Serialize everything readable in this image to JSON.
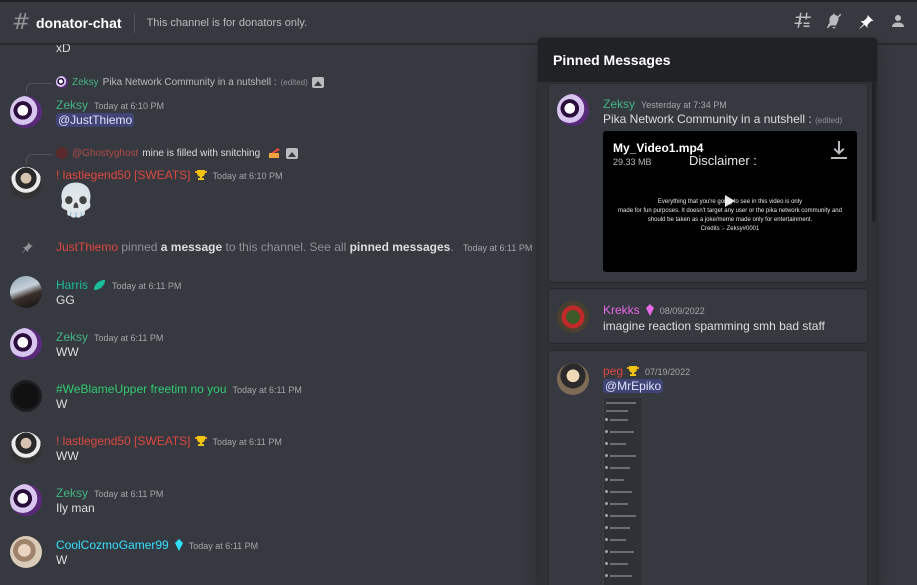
{
  "header": {
    "hash": "#",
    "channel_name": "donator-chat",
    "topic": "This channel is for donators only.",
    "tools": [
      "threads-icon",
      "mute-icon",
      "pin-icon",
      "members-icon"
    ]
  },
  "colors": {
    "zeksy": "#43b581",
    "legend": "#e0473f",
    "harris": "#1abc9c",
    "upper": "#2ecc71",
    "cozmo": "#31e0ff",
    "justthiemo": "#e0473f",
    "krekks": "#e867e8",
    "peg": "#e0473f",
    "ghosty": "#b04a4a"
  },
  "messages": {
    "top_text": "xD",
    "m1": {
      "reply_name": "Zeksy",
      "reply_text": "Pika Network Community in a nutshell :",
      "reply_edited": "(edited)",
      "name": "Zeksy",
      "time": "Today at 6:10 PM",
      "mention": "@JustThiemo"
    },
    "m2": {
      "reply_name": "@Ghostyghost",
      "reply_text": "mine is filled with snitching",
      "name": "! lastlegend50 [SWEATS]",
      "time": "Today at 6:10 PM",
      "emoji": "💀"
    },
    "sys": {
      "actor": "JustThiemo",
      "t1": "pinned",
      "link1": "a message",
      "t2": "to this channel. See all",
      "link2": "pinned messages",
      "t3": ".",
      "time": "Today at 6:11 PM"
    },
    "m3": {
      "name": "Harris",
      "time": "Today at 6:11 PM",
      "text": "GG"
    },
    "m4": {
      "name": "Zeksy",
      "time": "Today at 6:11 PM",
      "text": "WW"
    },
    "m5": {
      "name": "#WeBlameUpper freetim no you",
      "time": "Today at 6:11 PM",
      "text": "W"
    },
    "m6": {
      "name": "! lastlegend50 [SWEATS]",
      "time": "Today at 6:11 PM",
      "text": "WW"
    },
    "m7": {
      "name": "Zeksy",
      "time": "Today at 6:11 PM",
      "text": "Ily man"
    },
    "m8": {
      "name": "CoolCozmoGamer99",
      "time": "Today at 6:11 PM",
      "text": "W"
    }
  },
  "pinned": {
    "title": "Pinned Messages",
    "p1": {
      "name": "Zeksy",
      "time": "Yesterday at 7:34 PM",
      "text": "Pika Network Community in a nutshell :",
      "edited": "(edited)",
      "video_name": "My_Video1.mp4",
      "video_size": "29.33 MB",
      "video_title": "Disclaimer :",
      "video_line1": "Everything that you're going to see in this video is only",
      "video_line2": "made for fun purposes. It doesn't target any user or the pika network community and",
      "video_line3": "should be taken as a joke/meme made only for entertainment.",
      "video_line4": "Credits :- Zeksy#0001"
    },
    "p2": {
      "name": "Krekks",
      "time": "08/09/2022",
      "text": "imagine reaction spamming smh bad staff"
    },
    "p3": {
      "name": "peg",
      "time": "07/19/2022",
      "mention": "@MrEpiko"
    }
  }
}
